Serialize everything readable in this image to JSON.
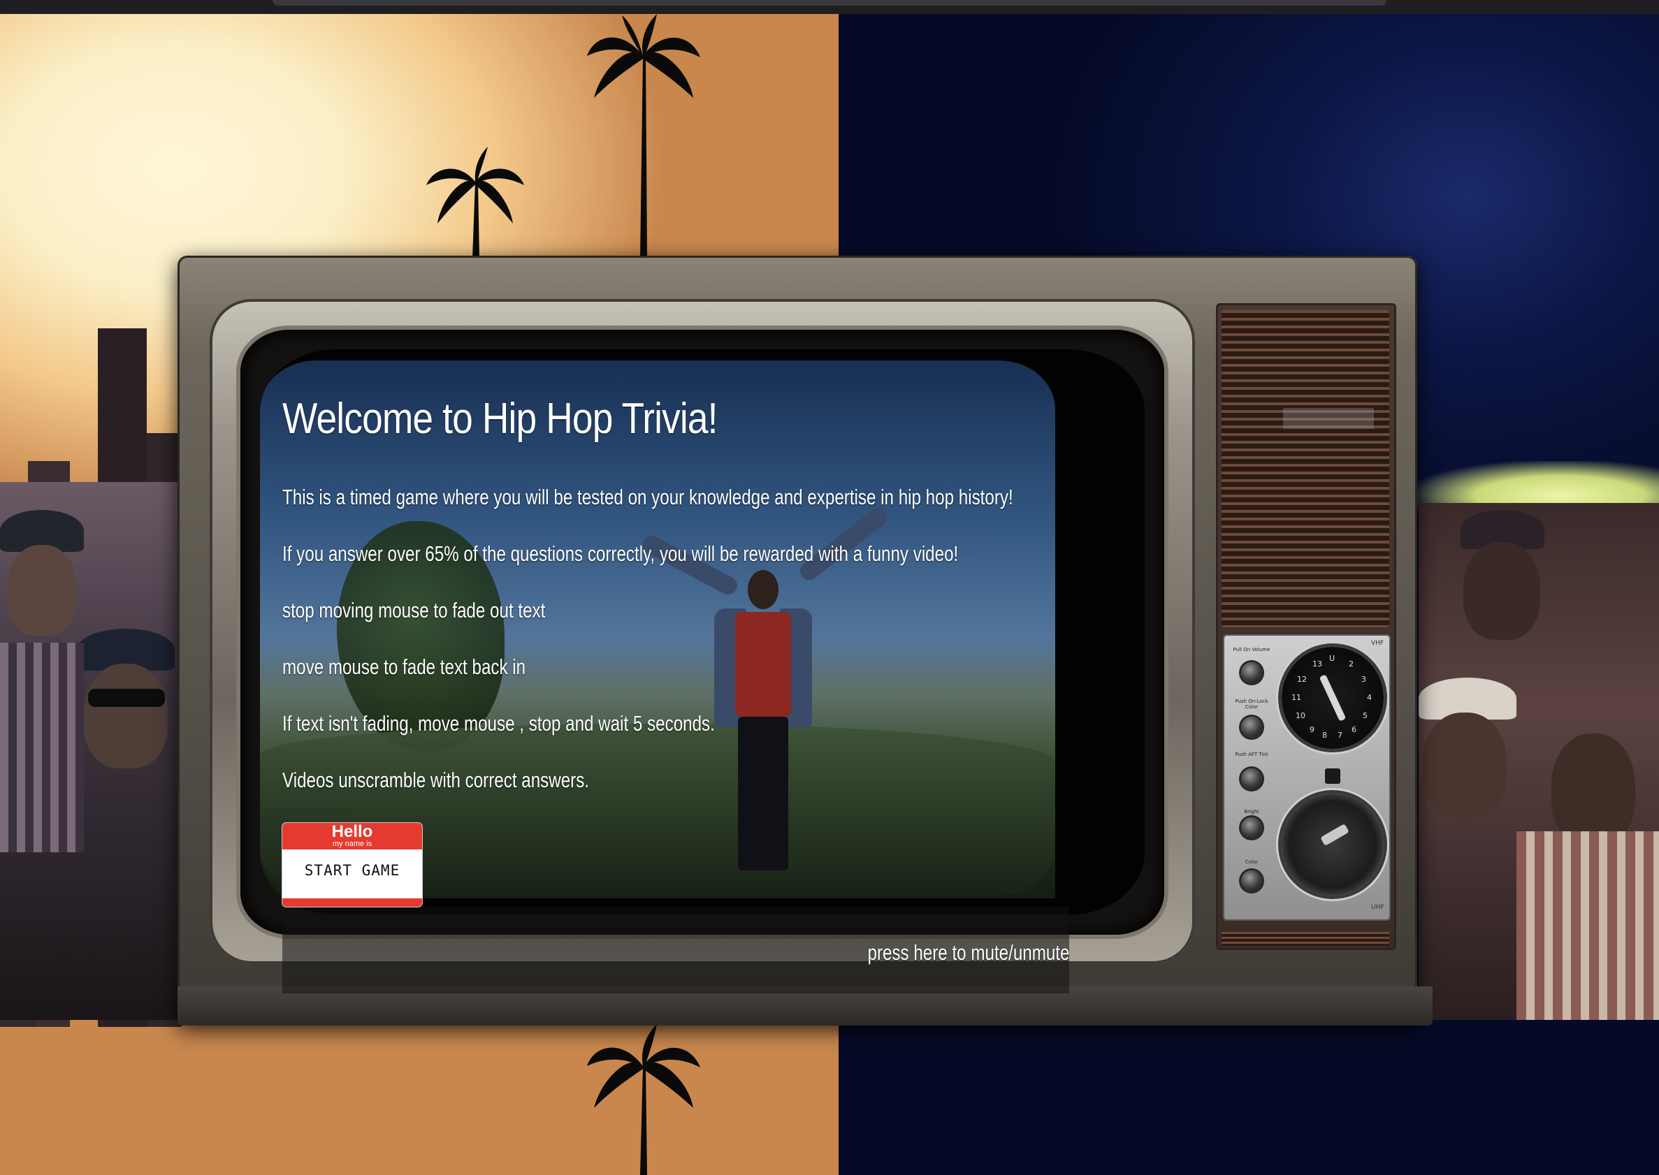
{
  "game": {
    "title": "Welcome to Hip Hop Trivia!",
    "instructions": [
      "This is a timed game where you will be tested on your knowledge and expertise in hip hop history!",
      "If you answer over 65% of the questions correctly, you will be rewarded with a funny video!",
      "stop moving mouse to fade out text",
      "move mouse to fade text back in",
      "If text isn't fading, move mouse , stop and wait 5 seconds.",
      "Videos unscramble with correct answers."
    ],
    "start_button": {
      "hello": "Hello",
      "subtitle": "my name is",
      "label": "START GAME"
    },
    "mute_label": "press here to mute/unmute"
  },
  "tv_controls": {
    "band_top": "VHF",
    "band_bottom": "UHF",
    "knob_labels": [
      "Pull On Volume",
      "Push On-Lock Color",
      "Push AFT Tint",
      "Bright",
      "Color"
    ],
    "dial_numbers": [
      "13",
      "U",
      "2",
      "12",
      "3",
      "11",
      "4",
      "10",
      "5",
      "9",
      "8",
      "7",
      "6"
    ]
  },
  "colors": {
    "tag_red": "#e53a2f",
    "text": "#ffffff",
    "sky_left": "#fbefc7",
    "sky_right": "#0c1645"
  }
}
